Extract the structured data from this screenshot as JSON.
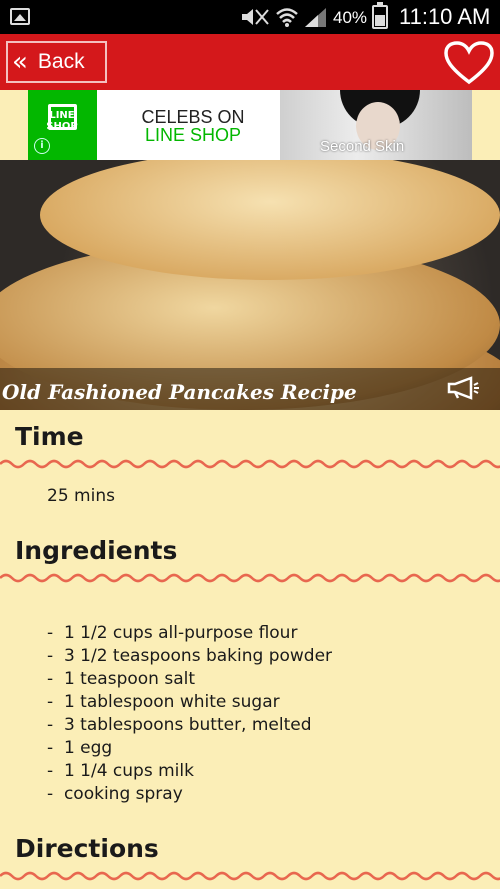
{
  "status_bar": {
    "battery": "40%",
    "time": "11:10 AM",
    "icons": [
      "gallery-icon",
      "mute-icon",
      "wifi-icon",
      "signal-icon",
      "battery-icon"
    ]
  },
  "app_bar": {
    "back_label": "Back",
    "back_icon": "double-chevron-left-icon",
    "favorite_icon": "heart-icon",
    "color": "#d4181b"
  },
  "ad": {
    "logo_text": "LINE SHOP",
    "line1": "CELEBS ON",
    "line2": "LINE SHOP",
    "photo_label": "Second Skin",
    "brand_color": "#03b700"
  },
  "hero": {
    "title": "Old Fashioned Pancakes Recipe",
    "share_icon": "megaphone-icon"
  },
  "sections": {
    "time_heading": "Time",
    "time_value": "25 mins",
    "ingredients_heading": "Ingredients",
    "directions_heading": "Directions"
  },
  "ingredients": [
    "1 1/2 cups all-purpose flour",
    "3 1/2 teaspoons baking powder",
    "1 teaspoon salt",
    "1 tablespoon white sugar",
    "3 tablespoons butter, melted",
    "1 egg",
    "1 1/4 cups milk",
    "cooking spray"
  ],
  "colors": {
    "background": "#fbeeb7",
    "wavy_divider": "#e8674f"
  }
}
